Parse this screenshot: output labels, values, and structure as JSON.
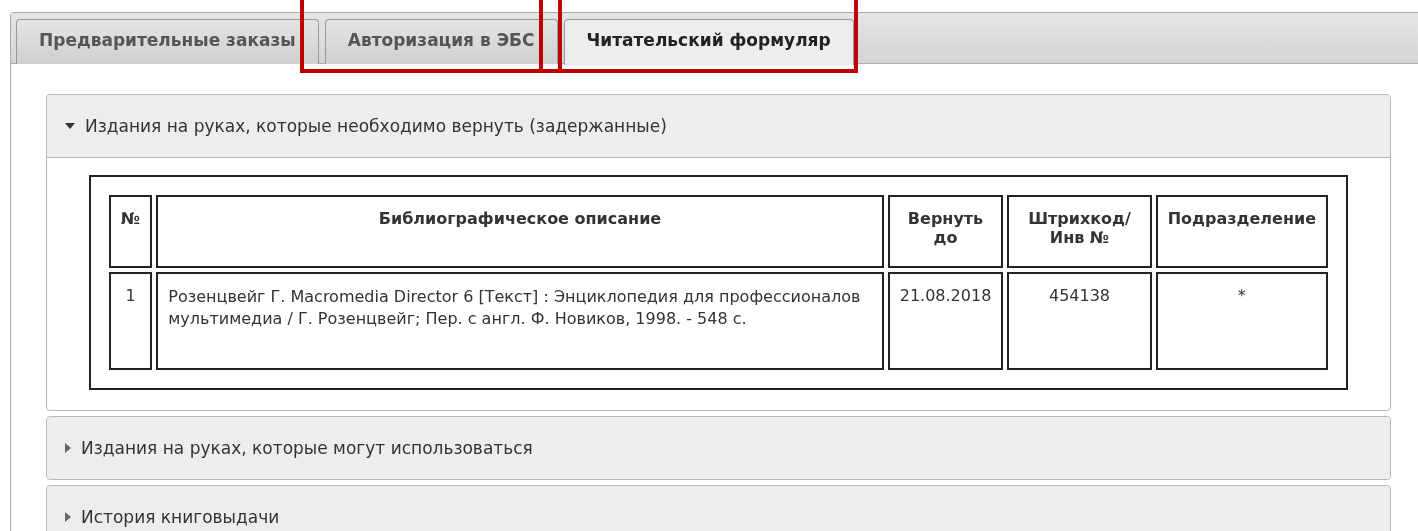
{
  "tabs": [
    {
      "label": "Предварительные заказы",
      "selected": false,
      "highlighted": false
    },
    {
      "label": "Авторизация в ЭБС",
      "selected": false,
      "highlighted": true
    },
    {
      "label": "Читательский формуляр",
      "selected": true,
      "highlighted": true
    }
  ],
  "sections": [
    {
      "title": "Издания на руках, которые необходимо вернуть (задержанные)",
      "expanded": true,
      "table": {
        "columns": [
          "№",
          "Библиографическое описание",
          "Вернуть до",
          "Штрихкод/Инв №",
          "Подразделение"
        ],
        "rows": [
          [
            "1",
            "Розенцвейг Г. Macromedia Director 6 [Текст] : Энциклопедия для профессионалов мультимедиа / Г. Розенцвейг; Пер. с англ. Ф. Новиков, 1998. - 548 с.",
            "21.08.2018",
            "454138",
            "*"
          ]
        ]
      }
    },
    {
      "title": "Издания на руках, которые могут использоваться",
      "expanded": false
    },
    {
      "title": "История книговыдачи",
      "expanded": false
    }
  ]
}
